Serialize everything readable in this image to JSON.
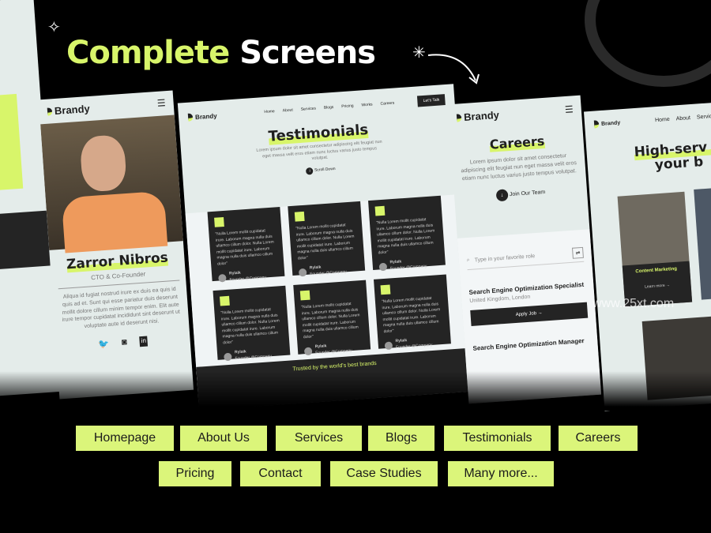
{
  "headline": {
    "part1": "Complete",
    "part2": "Screens"
  },
  "brand": "Brandy",
  "profile": {
    "name": "Zarror Nibros",
    "role": "CTO & Co-Founder",
    "bio": "Aliqua id fugiat nostrud irure ex duis ea quis id quis ad et. Sunt qui esse pariatur duis deserunt mollit dolore cillum minim tempor enim. Elit aute irure tempor cupidatat incididunt sint deserunt ut voluptate aute id deserunt nisi.",
    "social": [
      "twitter-icon",
      "instagram-icon",
      "linkedin-icon"
    ]
  },
  "testimonials": {
    "nav": [
      "Home",
      "About",
      "Services",
      "Blogs",
      "Pricing",
      "Works",
      "Careers"
    ],
    "cta": "Let's Talk",
    "title": "Testimonials",
    "subtitle": "Lorem ipsum dolor sit amet consectetur adipiscing elit feugiat nun eget massa velit eros etiam nunc luctus varius justo tempus volutpat.",
    "scroll": "Scroll Down",
    "quote": "\"Nulla Lorem mollit cupidatat irure. Laborum magna nulla duis ullamco cillum dolor. Nulla Lorem mollit cupidatat irure. Laborum magna nulla duis ullamco cillum dolor\"",
    "author": "Rylaik",
    "author_role": "Founder @Company",
    "trusted": "Trusted by the world's best brands"
  },
  "careers": {
    "title": "Careers",
    "subtitle": "Lorem ipsum dolor sit amet consectetur adipiscing elit feugiat nun eget massa velit eros etiam nunc luctus varius justo tempus volutpat.",
    "join": "Join Our Team",
    "search_placeholder": "Type in your favorite role",
    "jobs": [
      {
        "title": "Search Engine Optimization Specialist",
        "location": "United Kingdom, London",
        "apply": "Apply Job →"
      },
      {
        "title": "Search Engine Optimization Manager"
      }
    ]
  },
  "services": {
    "nav": [
      "Home",
      "About",
      "Services"
    ],
    "title1": "High-serv",
    "title2": "your b",
    "card_title": "Content Marketing",
    "learn": "Learn more →"
  },
  "watermark": "www.25xt.com",
  "tags": [
    "Homepage",
    "About Us",
    "Services",
    "Blogs",
    "Testimonials",
    "Careers",
    "Pricing",
    "Contact",
    "Case Studies",
    "Many more..."
  ],
  "colors": {
    "accent": "#d8f56a",
    "background": "#000000",
    "panel": "#e4ecea",
    "dark": "#242424"
  }
}
